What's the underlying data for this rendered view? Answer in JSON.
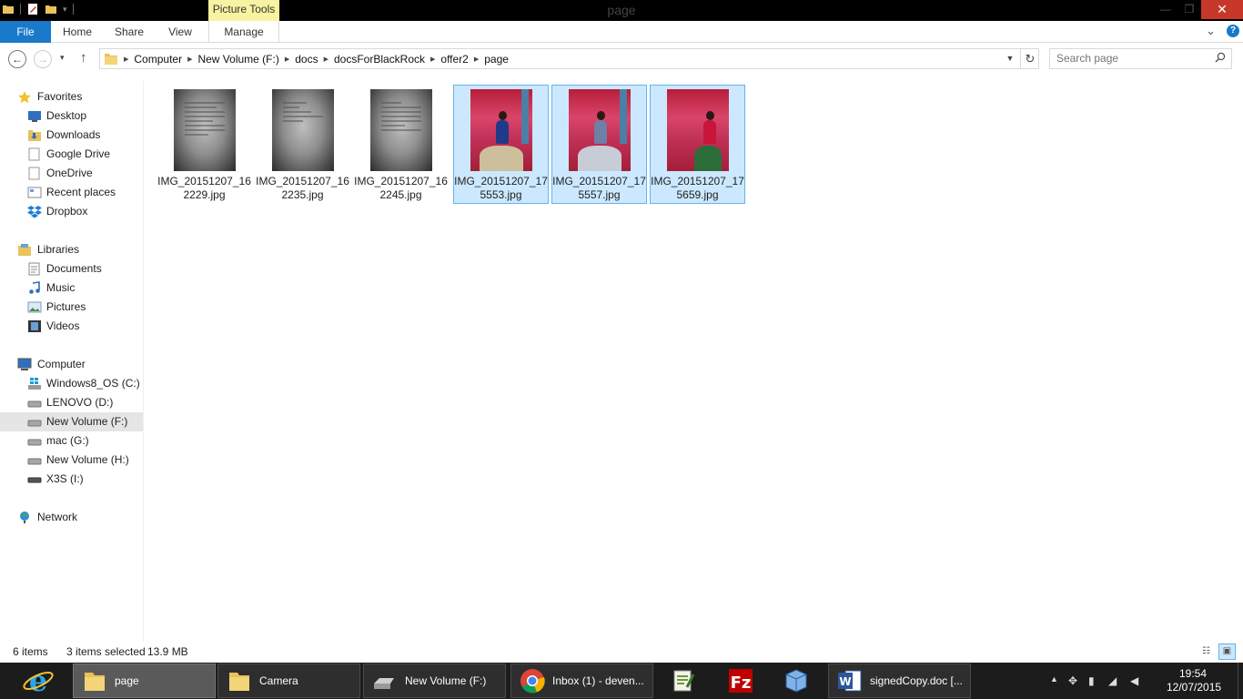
{
  "window": {
    "title": "page",
    "contextual_tab": "Picture Tools",
    "min_label": "—",
    "max_label": "❐",
    "close_label": "✕"
  },
  "ribbon": {
    "tabs": [
      {
        "label": "File"
      },
      {
        "label": "Home"
      },
      {
        "label": "Share"
      },
      {
        "label": "View"
      },
      {
        "label": "Manage"
      }
    ],
    "help_label": "?",
    "expand_label": "⌄"
  },
  "nav": {
    "back": "←",
    "forward": "→",
    "recent": "▾",
    "up": "↑"
  },
  "address": {
    "crumbs": [
      "Computer",
      "New Volume (F:)",
      "docs",
      "docsForBlackRock",
      "offer2",
      "page"
    ],
    "dropdown": "▼",
    "refresh": "↻"
  },
  "search": {
    "placeholder": "Search page",
    "icon": "search-icon"
  },
  "sidebar": {
    "favorites": {
      "label": "Favorites",
      "items": [
        {
          "label": "Desktop",
          "icon": "desktop-icon"
        },
        {
          "label": "Downloads",
          "icon": "downloads-folder-icon"
        },
        {
          "label": "Google Drive",
          "icon": "google-drive-icon"
        },
        {
          "label": "OneDrive",
          "icon": "onedrive-icon"
        },
        {
          "label": "Recent places",
          "icon": "recent-places-icon"
        },
        {
          "label": "Dropbox",
          "icon": "dropbox-icon"
        }
      ]
    },
    "libraries": {
      "label": "Libraries",
      "items": [
        {
          "label": "Documents",
          "icon": "documents-icon"
        },
        {
          "label": "Music",
          "icon": "music-icon"
        },
        {
          "label": "Pictures",
          "icon": "pictures-icon"
        },
        {
          "label": "Videos",
          "icon": "videos-icon"
        }
      ]
    },
    "computer": {
      "label": "Computer",
      "items": [
        {
          "label": "Windows8_OS (C:)",
          "icon": "windows-drive-icon"
        },
        {
          "label": "LENOVO (D:)",
          "icon": "drive-icon"
        },
        {
          "label": "New Volume (F:)",
          "icon": "drive-icon",
          "selected": true
        },
        {
          "label": "mac (G:)",
          "icon": "drive-icon"
        },
        {
          "label": "New Volume (H:)",
          "icon": "drive-icon"
        },
        {
          "label": "X3S (I:)",
          "icon": "removable-drive-icon"
        }
      ]
    },
    "network": {
      "label": "Network"
    }
  },
  "files": [
    {
      "name_line1": "IMG_20151207_16",
      "name_line2": "2229.jpg",
      "kind": "document",
      "selected": false
    },
    {
      "name_line1": "IMG_20151207_16",
      "name_line2": "2235.jpg",
      "kind": "document",
      "selected": false
    },
    {
      "name_line1": "IMG_20151207_16",
      "name_line2": "2245.jpg",
      "kind": "document",
      "selected": false
    },
    {
      "name_line1": "IMG_20151207_17",
      "name_line2": "5553.jpg",
      "kind": "photo",
      "selected": true
    },
    {
      "name_line1": "IMG_20151207_17",
      "name_line2": "5557.jpg",
      "kind": "photo",
      "selected": true
    },
    {
      "name_line1": "IMG_20151207_17",
      "name_line2": "5659.jpg",
      "kind": "photo",
      "selected": true
    }
  ],
  "status": {
    "items_count": "6 items",
    "selected": "3 items selected",
    "size": "13.9 MB"
  },
  "taskbar": {
    "buttons": [
      {
        "label": "page",
        "icon": "folder-icon",
        "active": true
      },
      {
        "label": "Camera",
        "icon": "folder-icon",
        "active": false
      },
      {
        "label": "New Volume (F:)",
        "icon": "drive-icon",
        "active": false
      },
      {
        "label": "Inbox (1) - deven...",
        "icon": "chrome-icon",
        "active": false
      },
      {
        "label": "signedCopy.doc [...",
        "icon": "word-icon",
        "active": false
      }
    ],
    "pinned": [
      {
        "icon": "internet-explorer-icon"
      },
      {
        "icon": "notepad-plus-plus-icon"
      },
      {
        "icon": "filezilla-icon"
      },
      {
        "icon": "virtualbox-icon"
      }
    ],
    "clock": {
      "time": "19:54",
      "date": "12/07/2015"
    }
  },
  "colors": {
    "accent": "#1979ca",
    "selection_bg": "#cce8ff",
    "selection_border": "#66b4e8",
    "taskbar": "#1c1c1c"
  }
}
